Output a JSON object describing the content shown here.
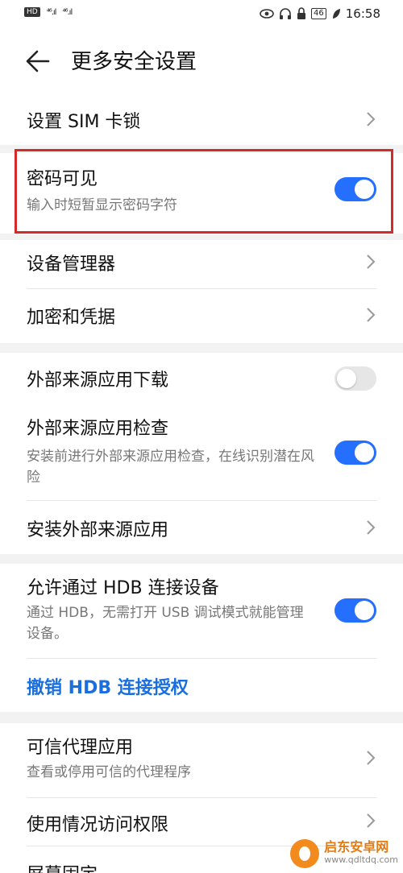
{
  "status_bar": {
    "hd_badge": "HD",
    "signal_1": "⁴⁶.ıl",
    "signal_2": "⁴⁶.ıl",
    "battery": "46",
    "time": "16:58"
  },
  "header": {
    "title": "更多安全设置"
  },
  "items": {
    "sim_lock": "设置 SIM 卡锁",
    "password_visible": {
      "title": "密码可见",
      "subtitle": "输入时短暂显示密码字符",
      "enabled": true
    },
    "device_manager": "设备管理器",
    "encryption": "加密和凭据",
    "external_download": {
      "title": "外部来源应用下载",
      "enabled": false
    },
    "external_check": {
      "title": "外部来源应用检查",
      "subtitle": "安装前进行外部来源应用检查，在线识别潜在风险",
      "enabled": true
    },
    "install_external": "安装外部来源应用",
    "hdb_connect": {
      "title": "允许通过 HDB 连接设备",
      "subtitle": "通过 HDB，无需打开 USB 调试模式就能管理设备。",
      "enabled": true
    },
    "revoke_hdb": "撤销 HDB 连接授权",
    "trust_agents": {
      "title": "可信代理应用",
      "subtitle": "查看或停用可信的代理程序"
    },
    "usage_access": "使用情况访问权限",
    "screen_pinning": "屏幕固定"
  },
  "watermark": {
    "name": "启东安卓网",
    "url": "www.qdltdq.com"
  },
  "colors": {
    "accent": "#256fff",
    "highlight": "#d42a2a",
    "link": "#1a6fe0"
  }
}
